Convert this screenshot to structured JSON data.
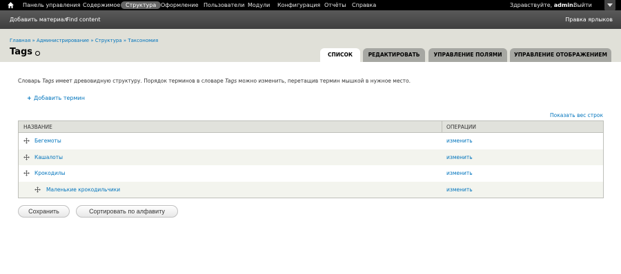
{
  "toolbar": {
    "items": [
      {
        "label": "Панель управления"
      },
      {
        "label": "Содержимое"
      },
      {
        "label": "Структура",
        "active": true
      },
      {
        "label": "Оформление"
      },
      {
        "label": "Пользователи"
      },
      {
        "label": "Модули"
      },
      {
        "label": "Конфигурация"
      },
      {
        "label": "Отчёты"
      },
      {
        "label": "Справка"
      }
    ],
    "greeting_prefix": "Здравствуйте,",
    "username": "admin.",
    "logout": "Выйти"
  },
  "shortcuts": {
    "items": [
      "Добавить материал",
      "Find content"
    ],
    "edit_label": "Правка ярлыков"
  },
  "breadcrumb": [
    "Главная",
    "Администрирование",
    "Структура",
    "Таксономия"
  ],
  "page_title": "Tags",
  "tabs": [
    {
      "label": "СПИСОК",
      "active": true
    },
    {
      "label": "РЕДАКТИРОВАТЬ"
    },
    {
      "label": "УПРАВЛЕНИЕ ПОЛЯМИ"
    },
    {
      "label": "УПРАВЛЕНИЕ ОТОБРАЖЕНИЕМ"
    }
  ],
  "description": {
    "part1": "Словарь ",
    "vocab1": "Tags",
    "part2": " имеет древовидную структуру. Порядок терминов в словаре ",
    "vocab2": "Tags",
    "part3": " можно изменить, перетащив термин мышкой в нужное место."
  },
  "add_term": "Добавить термин",
  "show_weights": "Показать вес строк",
  "table": {
    "headers": {
      "name": "НАЗВАНИЕ",
      "operations": "ОПЕРАЦИИ"
    },
    "rows": [
      {
        "name": "Бегемоты",
        "op": "изменить",
        "depth": 0
      },
      {
        "name": "Кашалоты",
        "op": "изменить",
        "depth": 0
      },
      {
        "name": "Крокодилы",
        "op": "изменить",
        "depth": 0
      },
      {
        "name": "Маленькие крокодильчики",
        "op": "изменить",
        "depth": 1
      }
    ]
  },
  "buttons": {
    "save": "Сохранить",
    "sort": "Сортировать по алфавиту"
  },
  "colors": {
    "link": "#0074bd",
    "toolbar": "#000000",
    "header_bg": "#e0e0d8",
    "tab_inactive": "#a6a7a2"
  }
}
